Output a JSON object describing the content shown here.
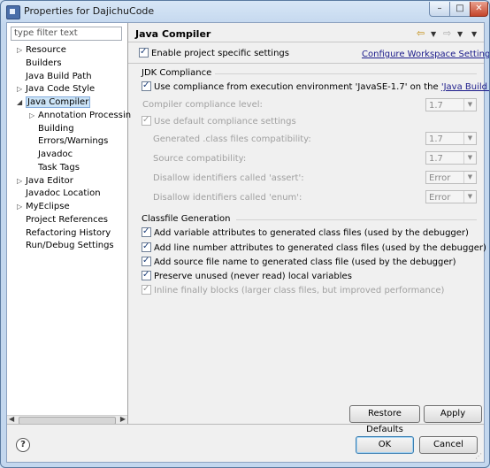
{
  "window": {
    "title": "Properties for DajichuCode"
  },
  "filter": {
    "placeholder": "type filter text"
  },
  "tree": [
    {
      "label": "Resource",
      "arrow": "▷"
    },
    {
      "label": "Builders",
      "arrow": ""
    },
    {
      "label": "Java Build Path",
      "arrow": ""
    },
    {
      "label": "Java Code Style",
      "arrow": "▷"
    },
    {
      "label": "Java Compiler",
      "arrow": "◢"
    },
    {
      "label": "Annotation Processin",
      "arrow": "▷"
    },
    {
      "label": "Building",
      "arrow": ""
    },
    {
      "label": "Errors/Warnings",
      "arrow": ""
    },
    {
      "label": "Javadoc",
      "arrow": ""
    },
    {
      "label": "Task Tags",
      "arrow": ""
    },
    {
      "label": "Java Editor",
      "arrow": "▷"
    },
    {
      "label": "Javadoc Location",
      "arrow": ""
    },
    {
      "label": "MyEclipse",
      "arrow": "▷"
    },
    {
      "label": "Project References",
      "arrow": ""
    },
    {
      "label": "Refactoring History",
      "arrow": ""
    },
    {
      "label": "Run/Debug Settings",
      "arrow": ""
    }
  ],
  "page": {
    "title": "Java Compiler",
    "enable_specific": "Enable project specific settings",
    "configure_link": "Configure Workspace Settings...",
    "jdk_group": "JDK Compliance",
    "use_compliance_prefix": "Use compliance from execution environment 'JavaSE-1.7' on the ",
    "java_build_path_link": "'Java Build Path'",
    "compliance_level_label": "Compiler compliance level:",
    "compliance_level_value": "1.7",
    "use_default": "Use default compliance settings",
    "generated_label": "Generated .class files compatibility:",
    "generated_value": "1.7",
    "source_label": "Source compatibility:",
    "source_value": "1.7",
    "assert_label": "Disallow identifiers called 'assert':",
    "assert_value": "Error",
    "enum_label": "Disallow identifiers called 'enum':",
    "enum_value": "Error",
    "classfile_group": "Classfile Generation",
    "cf_1": "Add variable attributes to generated class files (used by the debugger)",
    "cf_2": "Add line number attributes to generated class files (used by the debugger)",
    "cf_3": "Add source file name to generated class file (used by the debugger)",
    "cf_4": "Preserve unused (never read) local variables",
    "cf_5": "Inline finally blocks (larger class files, but improved performance)"
  },
  "buttons": {
    "restore": "Restore Defaults",
    "apply": "Apply",
    "ok": "OK",
    "cancel": "Cancel"
  },
  "help_glyph": "?"
}
